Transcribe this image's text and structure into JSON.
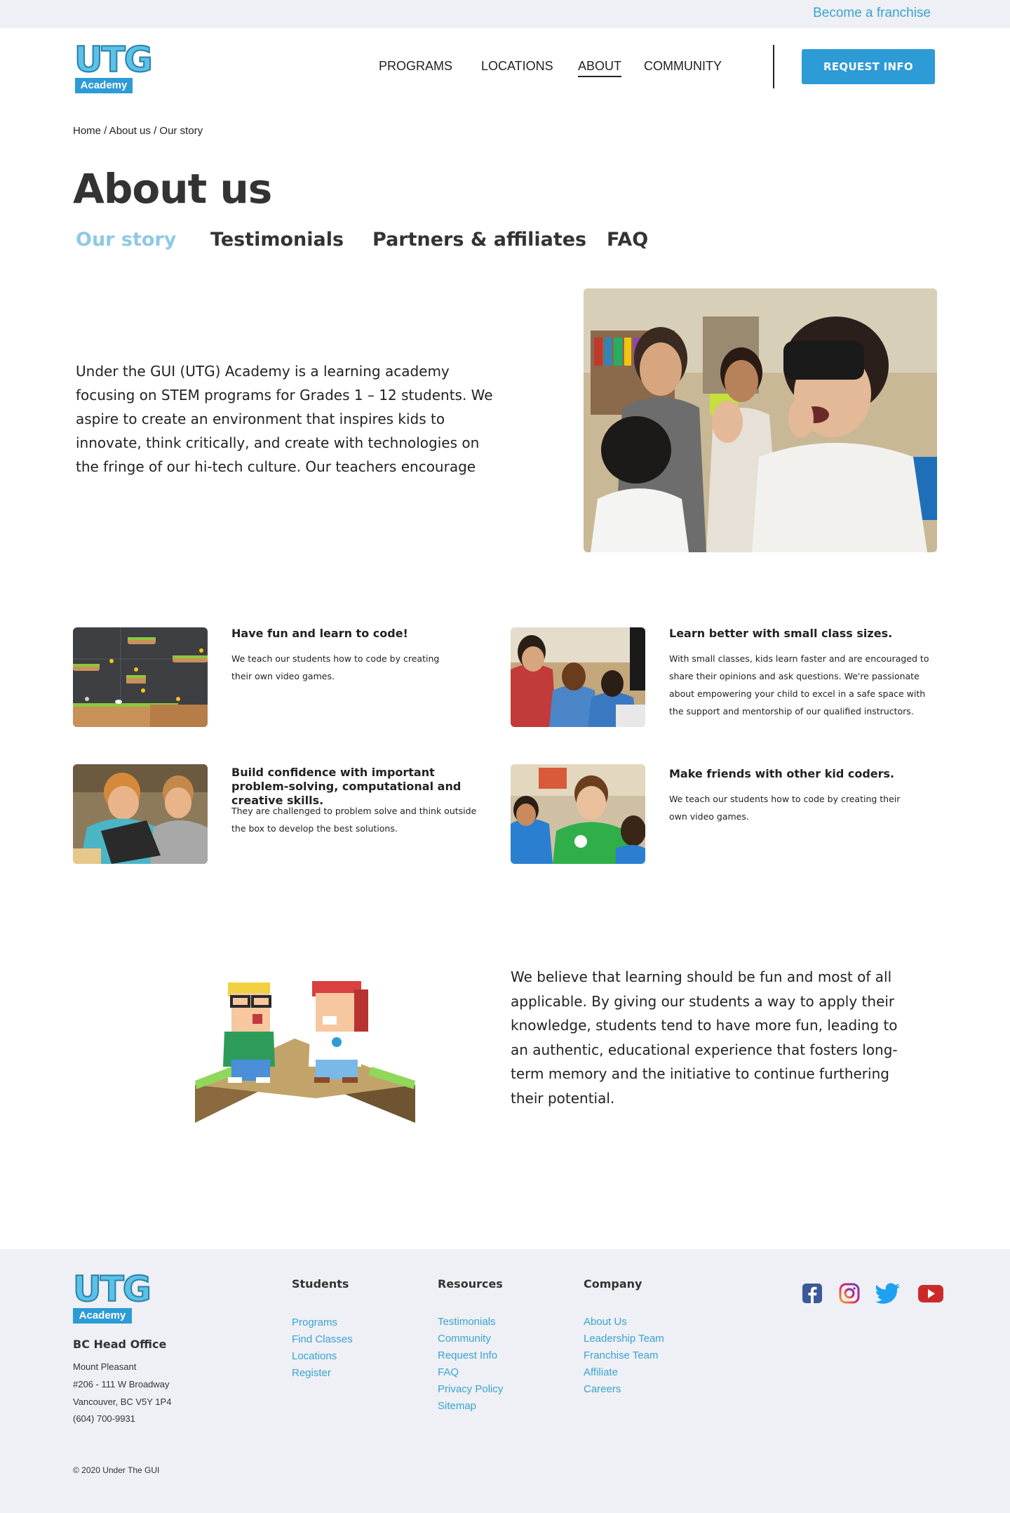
{
  "topbar": {
    "franchise_link": "Become a franchise"
  },
  "header": {
    "logo": {
      "text": "UTG",
      "sub": "Academy"
    },
    "nav": [
      {
        "label": "PROGRAMS"
      },
      {
        "label": "LOCATIONS"
      },
      {
        "label": "ABOUT",
        "active": true
      },
      {
        "label": "COMMUNITY"
      }
    ],
    "request_button": "REQUEST INFO"
  },
  "breadcrumb": "Home / About us / Our story",
  "page_title": "About us",
  "subtabs": [
    {
      "label": "Our story",
      "active": true
    },
    {
      "label": "Testimonials"
    },
    {
      "label": "Partners & affiliates"
    },
    {
      "label": "FAQ"
    }
  ],
  "intro_text": "Under the GUI (UTG) Academy is a learning academy focusing on STEM programs for Grades 1 – 12 students. We aspire to create an environment that inspires kids to innovate, think critically, and create with technologies on the fringe of our hi-tech culture. Our teachers encourage students to expand their",
  "features": [
    {
      "title": "Have fun and learn to code!",
      "text": "We teach our students how to code by creating their own video games."
    },
    {
      "title": "Learn better with small class sizes.",
      "text": "With small classes, kids learn faster and are encouraged to share their opinions and ask questions. We're passionate about empowering your child to excel in a safe space with the support and mentorship of our qualified instructors."
    },
    {
      "title": "Build confidence with important problem-solving, computational and creative skills.",
      "text": "They are challenged to problem solve and think outside the box to develop the best solutions."
    },
    {
      "title": "Make friends with other kid coders.",
      "text": "We teach our students how to code by creating their own video games."
    }
  ],
  "belief_text": "We believe that learning should be fun and most of all applicable. By giving our students a way to apply their knowledge, students tend to have more fun, leading to an authentic, educational experience that fosters long-term memory and the initiative to continue furthering their potential.",
  "footer": {
    "logo": {
      "text": "UTG",
      "sub": "Academy"
    },
    "office_title": "BC Head Office",
    "office_lines": [
      "Mount Pleasant",
      "#206 - 111 W Broadway",
      "Vancouver, BC V5Y 1P4",
      "(604) 700-9931"
    ],
    "columns": [
      {
        "title": "Students",
        "links": [
          "Programs",
          "Find Classes",
          "Locations",
          "Register"
        ]
      },
      {
        "title": "Resources",
        "links": [
          "Testimonials",
          "Community",
          "Request Info",
          "FAQ",
          "Privacy Policy",
          "Sitemap"
        ]
      },
      {
        "title": "Company",
        "links": [
          "About Us",
          "Leadership Team",
          "Franchise Team",
          "Affiliate",
          "Careers"
        ]
      }
    ],
    "social": [
      "facebook-icon",
      "instagram-icon",
      "twitter-icon",
      "youtube-icon"
    ],
    "copyright": "© 2020 Under The GUI"
  },
  "colors": {
    "accent": "#2d9bd6",
    "link": "#3aa3cf",
    "footer_bg": "#eef0f5",
    "active_tab": "#8ec9e6"
  }
}
